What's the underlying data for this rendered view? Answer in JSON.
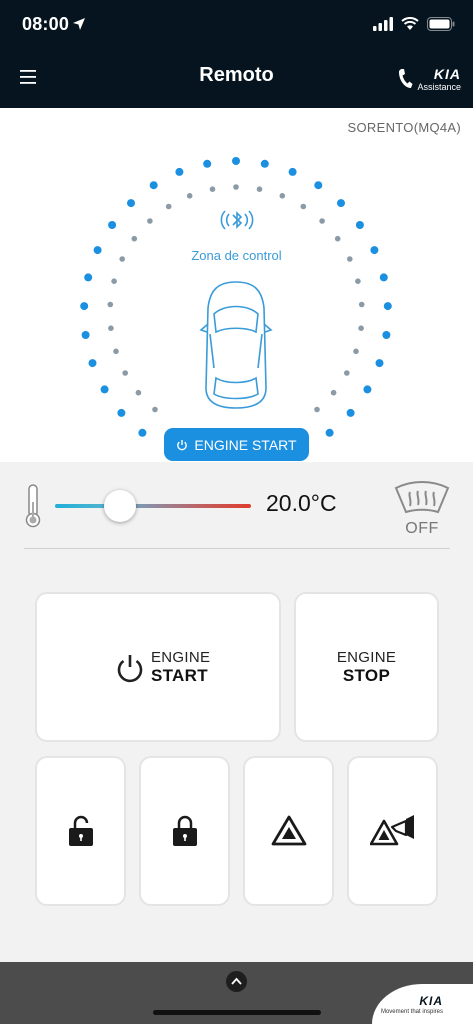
{
  "status_bar": {
    "time": "08:00"
  },
  "header": {
    "title": "Remoto",
    "assistance_logo": "KIA",
    "assistance_label": "Assistance"
  },
  "vehicle": {
    "model": "SORENTO(MQ4A)"
  },
  "control_zone": {
    "label": "Zona de control",
    "engine_start_pill": "ENGINE START",
    "colors": {
      "outer_dots": "#1b8fe0",
      "inner_dots": "#8a9aa6",
      "accent": "#1b8fe0"
    }
  },
  "climate": {
    "temperature": "20.0°C",
    "slider_fraction": 0.33,
    "defrost_status": "OFF"
  },
  "controls": {
    "engine_start": {
      "line1": "ENGINE",
      "line2": "START"
    },
    "engine_stop": {
      "line1": "ENGINE",
      "line2": "STOP"
    },
    "icons": [
      "unlock-icon",
      "lock-icon",
      "hazard-icon",
      "panic-horn-icon"
    ]
  },
  "footer": {
    "brand_logo": "KIA",
    "slogan": "Movement that inspires"
  }
}
